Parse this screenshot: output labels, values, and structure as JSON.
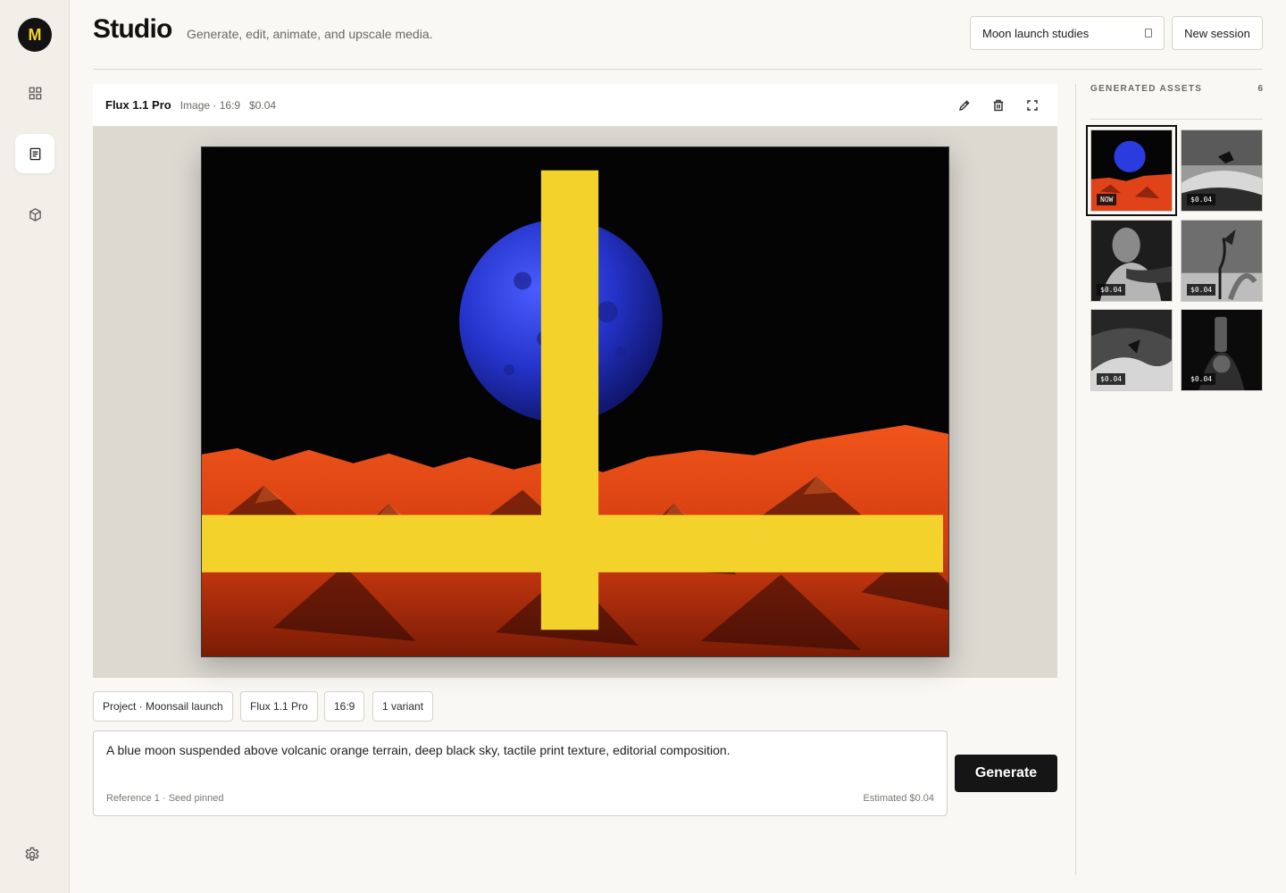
{
  "app": {
    "logo_letter": "M",
    "title": "Studio",
    "subtitle": "Generate, edit, animate, and upscale media."
  },
  "sidebar": {
    "items": [
      {
        "icon": "grid-icon",
        "active": false
      },
      {
        "icon": "document-icon",
        "active": true
      },
      {
        "icon": "cube-icon",
        "active": false
      }
    ],
    "footer_icon": "gear-icon"
  },
  "header": {
    "session_select": {
      "value": "Moon launch studies"
    },
    "new_session_label": "New session"
  },
  "canvas": {
    "model": "Flux 1.1 Pro",
    "meta": "Image · 16:9",
    "price": "$0.04",
    "tools": [
      "edit-icon",
      "delete-icon",
      "fullscreen-icon"
    ]
  },
  "chips": [
    "Project · Moonsail launch",
    "Flux 1.1 Pro",
    "16:9",
    "1 variant"
  ],
  "prompt": {
    "text": "A blue moon suspended above volcanic orange terrain, deep black sky, tactile print texture, editorial composition.",
    "meta": "Reference 1 · Seed pinned",
    "estimate": "Estimated $0.04"
  },
  "generate_label": "Generate",
  "assets": {
    "title": "GENERATED ASSETS",
    "count": "6",
    "items": [
      {
        "badge": "NOW",
        "selected": true
      },
      {
        "badge": "$0.04",
        "selected": false
      },
      {
        "badge": "$0.04",
        "selected": false
      },
      {
        "badge": "$0.04",
        "selected": false
      },
      {
        "badge": "$0.04",
        "selected": false
      },
      {
        "badge": "$0.04",
        "selected": false
      }
    ]
  },
  "colors": {
    "accent_logo": "#f3d22b",
    "moon_blue": "#2d3cd8",
    "terrain_orange": "#e24212",
    "primary_button": "#151515"
  }
}
